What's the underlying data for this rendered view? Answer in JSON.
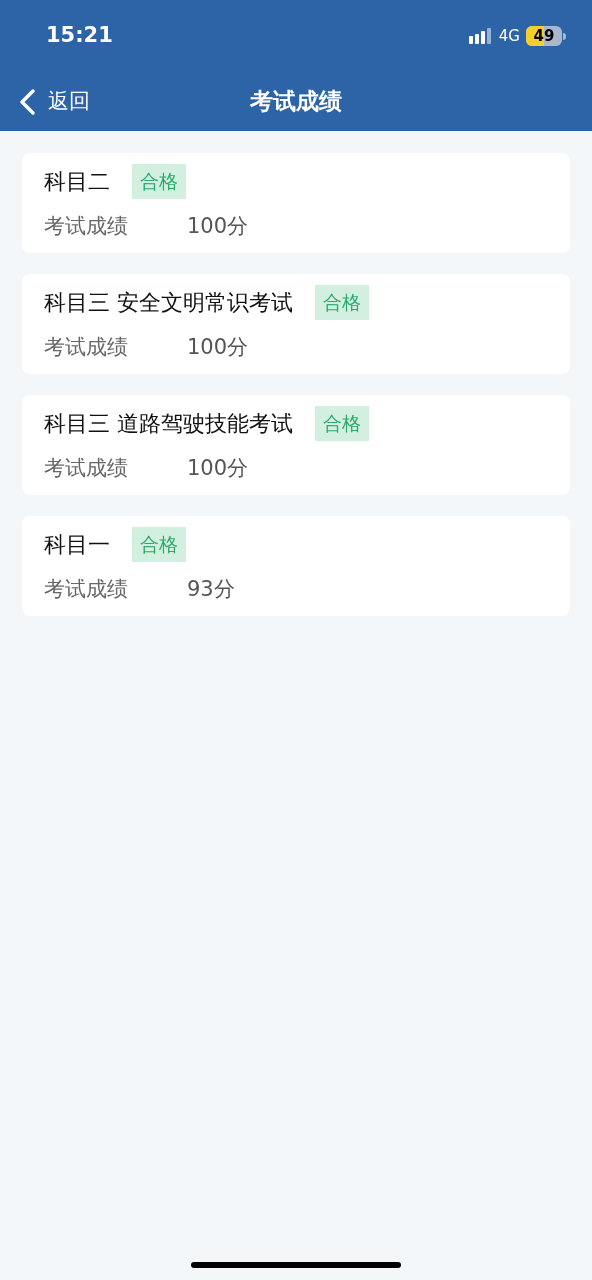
{
  "status_bar": {
    "time": "15:21",
    "network": "4G",
    "battery": "49"
  },
  "nav": {
    "back": "返回",
    "title": "考试成绩"
  },
  "results": [
    {
      "subject": "科目二",
      "status": "合格",
      "label": "考试成绩",
      "score": "100分"
    },
    {
      "subject": "科目三 安全文明常识考试",
      "status": "合格",
      "label": "考试成绩",
      "score": "100分"
    },
    {
      "subject": "科目三 道路驾驶技能考试",
      "status": "合格",
      "label": "考试成绩",
      "score": "100分"
    },
    {
      "subject": "科目一",
      "status": "合格",
      "label": "考试成绩",
      "score": "93分"
    }
  ]
}
